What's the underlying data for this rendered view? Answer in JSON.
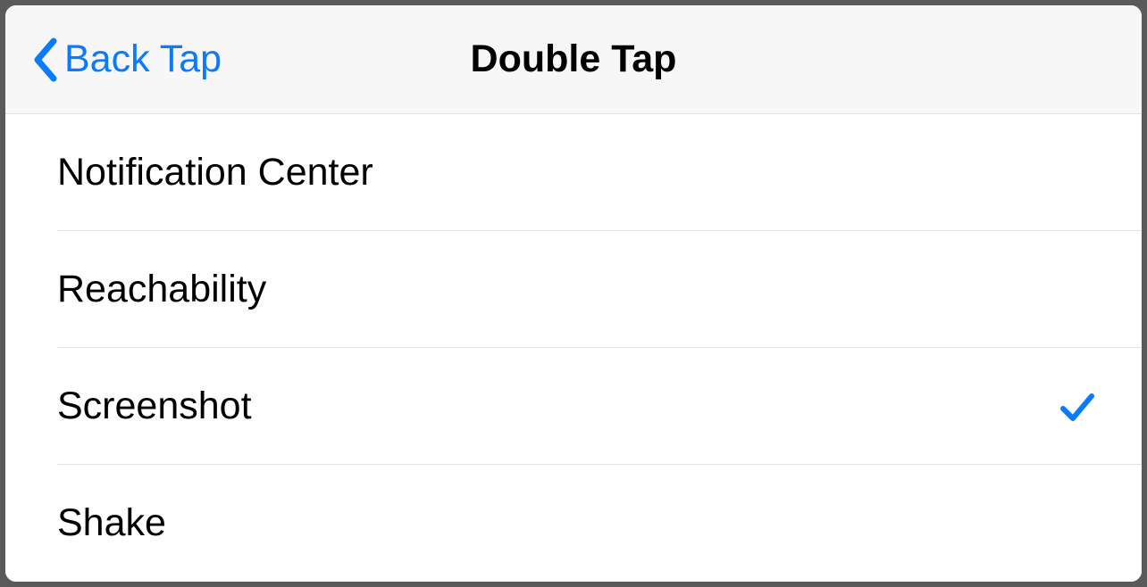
{
  "nav": {
    "back_label": "Back Tap",
    "title": "Double Tap"
  },
  "options": [
    {
      "label": "Notification Center",
      "selected": false
    },
    {
      "label": "Reachability",
      "selected": false
    },
    {
      "label": "Screenshot",
      "selected": true
    },
    {
      "label": "Shake",
      "selected": false
    }
  ],
  "colors": {
    "accent": "#0a7aff",
    "navbar_bg": "#f7f7f7",
    "separator": "#e3e3e3"
  }
}
